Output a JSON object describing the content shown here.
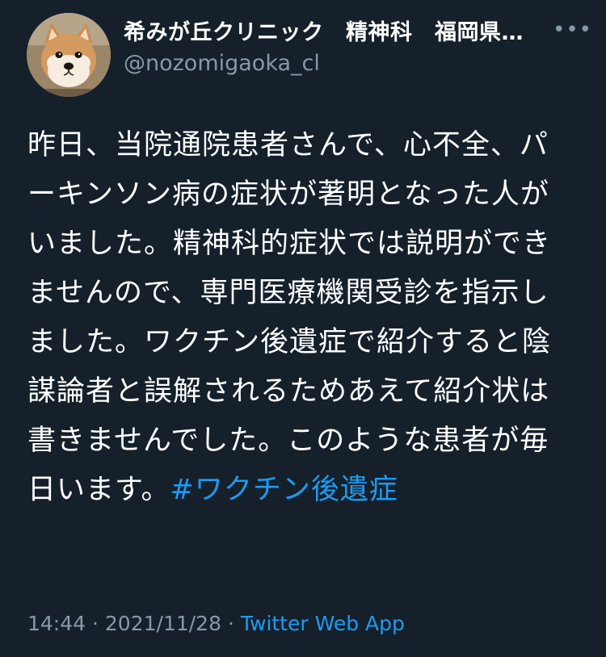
{
  "tweet": {
    "author": {
      "display_name": "希みが丘クリニック　精神科　福岡県…",
      "handle": "@nozomigaoka_cl",
      "avatar": "shiba-dog-avatar"
    },
    "more_icon": "more-dots-icon",
    "text": "昨日、当院通院患者さんで、心不全、パーキンソン病の症状が著明となった人がいました。精神科的症状では説明ができませんので、専門医療機関受診を指示しました。ワクチン後遺症で紹介すると陰謀論者と誤解されるためあえて紹介状は書きませんでした。このような患者が毎日います。",
    "hashtag": "#ワクチン後遺症",
    "time": "14:44",
    "separator": "·",
    "date": "2021/11/28",
    "source": "Twitter Web App"
  },
  "colors": {
    "background": "#15202b",
    "text": "#ffffff",
    "secondary": "#8899a6",
    "link": "#1d9bf0"
  }
}
